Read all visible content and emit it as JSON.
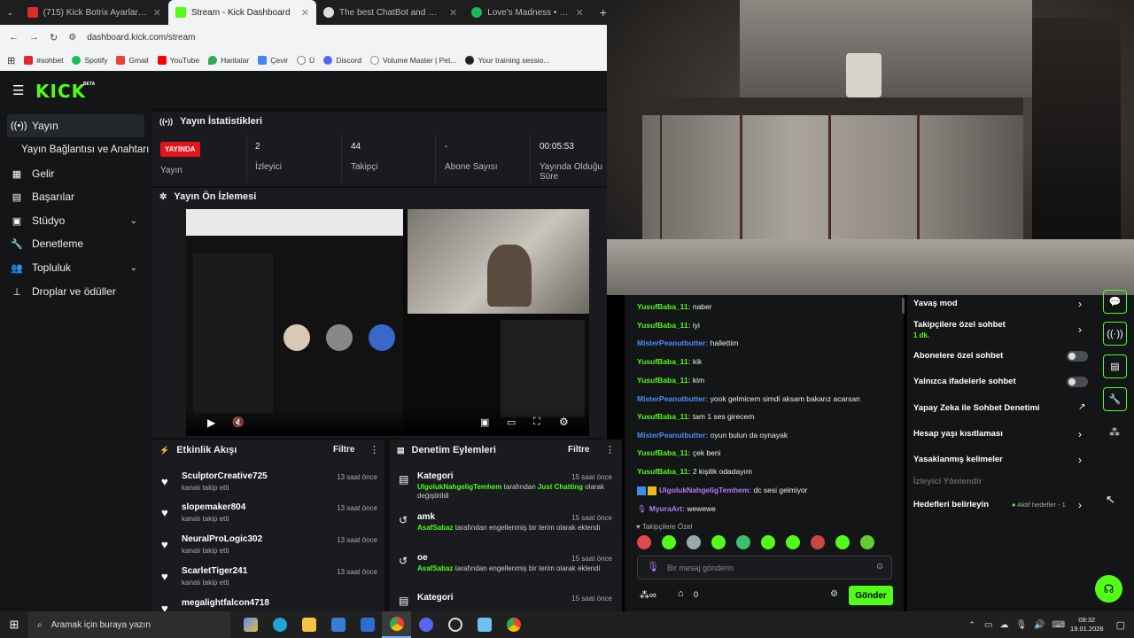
{
  "browser": {
    "tabs": [
      {
        "title": "(715) Kick Botrix Ayarları Nasıl",
        "color": "#e02a2a",
        "active": false
      },
      {
        "title": "Stream - Kick Dashboard",
        "color": "#53fc18",
        "active": true
      },
      {
        "title": "The best ChatBot and Widgets f",
        "color": "#444",
        "active": false
      },
      {
        "title": "Love's Madness • Lund Qu",
        "color": "#1db954",
        "active": false
      }
    ],
    "url": "dashboard.kick.com/stream",
    "bookmarks": [
      {
        "label": "#sohbet",
        "color": "#e02a2a"
      },
      {
        "label": "Spotify",
        "color": "#1db954"
      },
      {
        "label": "Gmail",
        "color": "#ea4335"
      },
      {
        "label": "YouTube",
        "color": "#ff0000"
      },
      {
        "label": "Haritalar",
        "color": "#34a853"
      },
      {
        "label": "Çevir",
        "color": "#4285f4"
      },
      {
        "label": "Ü",
        "color": "#777"
      },
      {
        "label": "Discord",
        "color": "#5865f2"
      },
      {
        "label": "Volume Master | Pet...",
        "color": "#888"
      },
      {
        "label": "Your training sessio...",
        "color": "#222"
      }
    ]
  },
  "header": {
    "logo": "KICK",
    "beta": "BETA"
  },
  "sidebar": {
    "items": [
      {
        "label": "Yayın",
        "icon": "broadcast-icon",
        "active": true,
        "chev": false
      },
      {
        "label": "Yayın Bağlantısı ve Anahtarı",
        "icon": "",
        "active": false,
        "chev": false
      },
      {
        "label": "Gelir",
        "icon": "revenue-icon",
        "active": false,
        "chev": false
      },
      {
        "label": "Başarılar",
        "icon": "achievements-icon",
        "active": false,
        "chev": false
      },
      {
        "label": "Stüdyo",
        "icon": "studio-icon",
        "active": false,
        "chev": true
      },
      {
        "label": "Denetleme",
        "icon": "wrench-icon",
        "active": false,
        "chev": false
      },
      {
        "label": "Topluluk",
        "icon": "community-icon",
        "active": false,
        "chev": true
      },
      {
        "label": "Droplar ve ödüller",
        "icon": "drops-icon",
        "active": false,
        "chev": false
      }
    ]
  },
  "stats": {
    "title": "Yayın İstatistikleri",
    "live_badge": "YAYINDA",
    "items": [
      {
        "value": "",
        "label": "Yayın"
      },
      {
        "value": "2",
        "label": "İzleyici"
      },
      {
        "value": "44",
        "label": "Takipçi"
      },
      {
        "value": "-",
        "label": "Abone Sayısı"
      },
      {
        "value": "00:05:53",
        "label": "Yayında Olduğu Süre"
      }
    ]
  },
  "preview": {
    "title": "Yayın Ön İzlemesi"
  },
  "activity": {
    "title": "Etkinlik Akışı",
    "filter": "Filtre",
    "items": [
      {
        "name": "SculptorCreative725",
        "sub": "kanalı takip etti",
        "time": "13 saat önce"
      },
      {
        "name": "slopemaker804",
        "sub": "kanalı takip etti",
        "time": "13 saat önce"
      },
      {
        "name": "NeuralProLogic302",
        "sub": "kanalı takip etti",
        "time": "13 saat önce"
      },
      {
        "name": "ScarletTiger241",
        "sub": "kanalı takip etti",
        "time": "13 saat önce"
      },
      {
        "name": "megalightfalcon4718",
        "sub": "",
        "time": ""
      }
    ]
  },
  "moderation": {
    "title": "Denetim Eylemleri",
    "filter": "Filtre",
    "items": [
      {
        "name": "Kategori",
        "user": "UlgolukNahgeligTemhem",
        "mid": " tarafından ",
        "cat": "Just Chatting",
        "rest": " olarak değiştirildi",
        "time": "15 saat önce",
        "icon": "category-icon"
      },
      {
        "name": "amk",
        "user": "AsafSabaz",
        "mid": " tarafından engellenmiş bir terim olarak eklendi",
        "cat": "",
        "rest": "",
        "time": "15 saat önce",
        "icon": "undo-icon"
      },
      {
        "name": "oe",
        "user": "AsafSabaz",
        "mid": " tarafından engellenmiş bir terim olarak eklendi",
        "cat": "",
        "rest": "",
        "time": "15 saat önce",
        "icon": "undo-icon"
      },
      {
        "name": "Kategori",
        "user": "",
        "mid": "",
        "cat": "",
        "rest": "",
        "time": "15 saat önce",
        "icon": "category-icon"
      }
    ]
  },
  "chat": {
    "messages": [
      {
        "user": "YusufBaba_11:",
        "text": " naber",
        "color": "#53fc18"
      },
      {
        "user": "YusufBaba_11:",
        "text": " iyi",
        "color": "#53fc18"
      },
      {
        "user": "MisterPeanutbutter:",
        "text": " hallettim",
        "color": "#4d8cf5"
      },
      {
        "user": "YusufBaba_11:",
        "text": " kik",
        "color": "#53fc18"
      },
      {
        "user": "YusufBaba_11:",
        "text": " kim",
        "color": "#53fc18"
      },
      {
        "user": "MisterPeanutbutter:",
        "text": " yook gelmicem simdi aksam bakarız acarsan",
        "color": "#4d8cf5"
      },
      {
        "user": "YusufBaba_11:",
        "text": " tam 1 ses girecem",
        "color": "#53fc18"
      },
      {
        "user": "MisterPeanutbutter:",
        "text": " oyun bulun da oynayak",
        "color": "#4d8cf5"
      },
      {
        "user": "YusufBaba_11:",
        "text": " çek beni",
        "color": "#53fc18"
      },
      {
        "user": "YusufBaba_11:",
        "text": " 2 kişilik odadayım",
        "color": "#53fc18"
      },
      {
        "user": "UlgolukNahgeligTemhem:",
        "text": " dc sesi gelmiyor",
        "color": "#b07bf5"
      },
      {
        "user": "MyuraArt:",
        "text": " wewewe",
        "color": "#b07bf5"
      }
    ],
    "followers_only": "Takipçilere Özel",
    "placeholder": "Bir mesaj gönderin",
    "points": "0",
    "send": "Gönder"
  },
  "settings": {
    "items": [
      {
        "label": "Yavaş mod",
        "sub": "",
        "type": "arrow"
      },
      {
        "label": "Takipçilere özel sohbet",
        "sub": "1 dk.",
        "type": "arrow"
      },
      {
        "label": "Abonelere özel sohbet",
        "sub": "",
        "type": "toggle"
      },
      {
        "label": "Yalnızca ifadelerle sohbet",
        "sub": "",
        "type": "toggle"
      },
      {
        "label": "Yapay Zeka ile Sohbet Denetimi",
        "sub": "",
        "type": "external"
      },
      {
        "label": "Hesap yaşı kısıtlaması",
        "sub": "",
        "type": "arrow"
      },
      {
        "label": "Yasaklanmış kelimeler",
        "sub": "",
        "type": "arrow"
      },
      {
        "label": "İzleyici Yönlendir",
        "sub": "",
        "type": "disabled"
      },
      {
        "label": "Hedefleri belirleyin",
        "sub": "",
        "type": "goal"
      }
    ],
    "goal_status": "Aktif hedefler - 1"
  },
  "taskbar": {
    "search": "Aramak için buraya yazın",
    "time": "08:32",
    "date": "19.01.2026"
  },
  "colors": {
    "accent": "#53fc18",
    "bg": "#141517",
    "panel": "#191b1f"
  }
}
